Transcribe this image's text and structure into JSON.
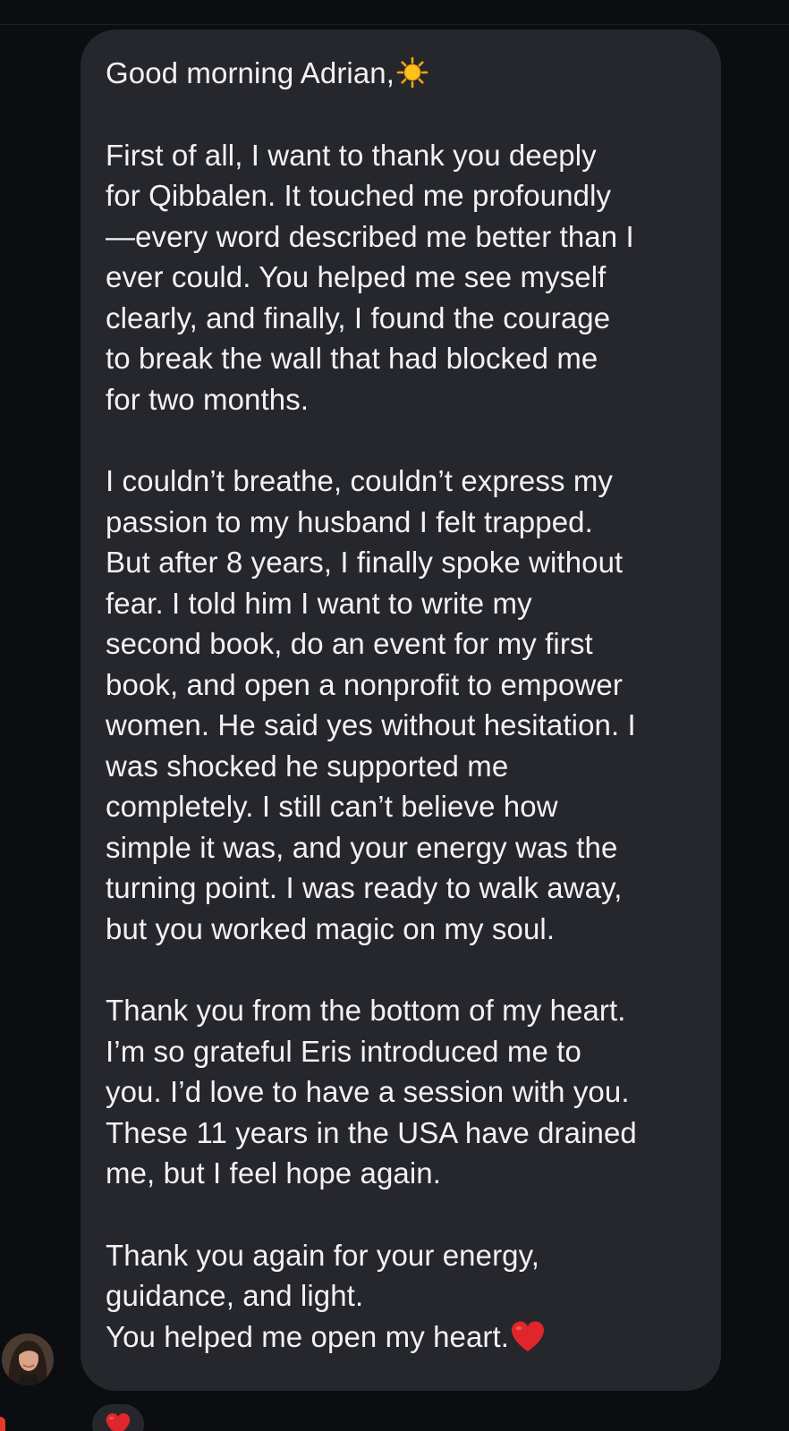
{
  "message": {
    "greeting": "Good morning Adrian,",
    "greeting_emoji": "sun-icon",
    "paragraphs": [
      [
        "First of all, I want to thank you deeply",
        "for Qibbalen. It touched me profoundly",
        "—every word described me better than I",
        "ever could. You helped me see myself",
        "clearly, and finally, I found the courage",
        "to break the wall that had blocked me",
        "for two months."
      ],
      [
        "I couldn’t breathe, couldn’t express my",
        "passion to my husband I felt trapped.",
        "But after 8 years, I finally spoke without",
        "fear. I told him I want to write my",
        "second book, do an event for my first",
        "book, and open a nonprofit to empower",
        "women. He said yes without hesitation. I",
        "was shocked he supported me",
        "completely. I still can’t believe how",
        "simple it was, and your energy was the",
        "turning point. I was ready to walk away,",
        "but you worked magic on my soul."
      ],
      [
        "Thank you from the bottom of my heart.",
        "I’m so grateful Eris introduced me to",
        "you. I’d love to have a session with you.",
        "These 11 years in the USA have drained",
        "me, but I feel hope again."
      ]
    ],
    "closing": {
      "line1": "Thank you again for your energy,",
      "line2": "guidance, and light.",
      "line3": "You helped me open my heart.",
      "line3_emoji": "red-heart-icon"
    }
  },
  "reaction": {
    "emoji": "red-heart-icon"
  },
  "colors": {
    "background": "#0c0d10",
    "bubble": "#26272c",
    "text": "#f2f2f4",
    "heart": "#e0262c"
  }
}
